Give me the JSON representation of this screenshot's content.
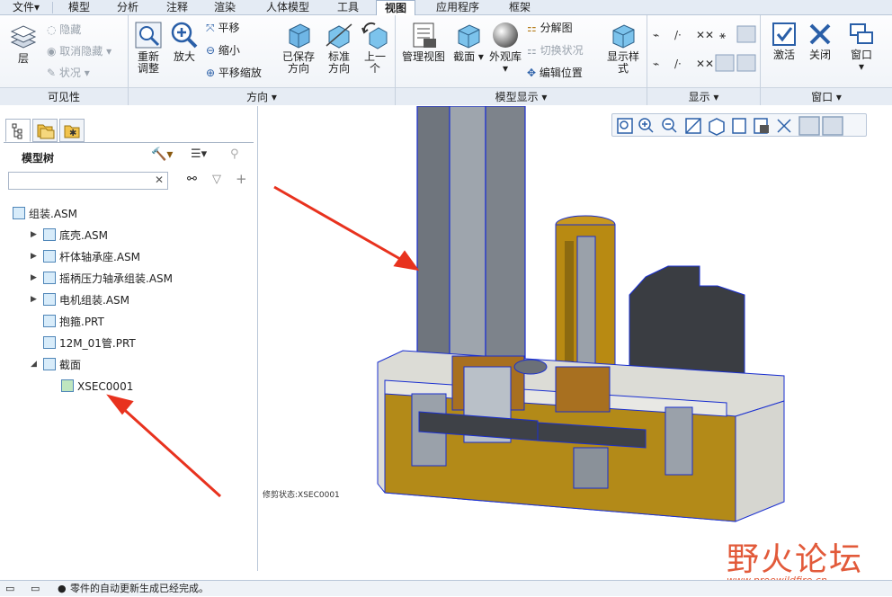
{
  "menubar": {
    "items": [
      "文件▾",
      "模型",
      "分析",
      "注释",
      "渲染",
      "人体模型",
      "工具",
      "视图",
      "应用程序",
      "框架"
    ],
    "active": "视图"
  },
  "ribbon": {
    "visibility": {
      "label": "可见性",
      "layer": "层",
      "hide": "隐藏",
      "unhide": "取消隐藏",
      "status": "状况"
    },
    "orientation": {
      "label": "方向",
      "refit": "重新调整",
      "zoom_in": "放大",
      "pan": "平移",
      "zoom_out": "缩小",
      "pan_zoom": "平移缩放",
      "saved_views": "已保存方向",
      "standard": "标准方向",
      "previous": "上一个"
    },
    "model_display": {
      "label": "模型显示",
      "manage_views": "管理视图",
      "section": "截面",
      "appearance": "外观库",
      "exploded": "分解图",
      "toggle_status": "切换状况",
      "edit_position": "编辑位置",
      "display_style": "显示样式"
    },
    "show": {
      "label": "显示"
    },
    "window": {
      "label": "窗口",
      "activate": "激活",
      "close": "关闭",
      "window": "窗口"
    }
  },
  "panel": {
    "title": "模型树",
    "search_placeholder": "",
    "tree": [
      {
        "name": "组装.ASM",
        "level": 0,
        "expand": ""
      },
      {
        "name": "底壳.ASM",
        "level": 1,
        "expand": "▶"
      },
      {
        "name": "杆体轴承座.ASM",
        "level": 1,
        "expand": "▶"
      },
      {
        "name": "摇柄压力轴承组装.ASM",
        "level": 1,
        "expand": "▶"
      },
      {
        "name": "电机组装.ASM",
        "level": 1,
        "expand": "▶"
      },
      {
        "name": "抱箍.PRT",
        "level": 1,
        "expand": ""
      },
      {
        "name": "12M_01管.PRT",
        "level": 1,
        "expand": ""
      },
      {
        "name": "截面",
        "level": 1,
        "expand": "◢"
      },
      {
        "name": "XSEC0001",
        "level": 2,
        "expand": ""
      }
    ]
  },
  "viewport": {
    "clip_status": "修剪状态:XSEC0001"
  },
  "status": {
    "message": "零件的自动更新生成已经完成。"
  },
  "watermark": {
    "main": "野火论坛",
    "sub": "www.proewildfire.cn"
  },
  "colors": {
    "accent": "#2a5fa8",
    "annotation_arrow": "#e8321e",
    "model_gold": "#b88a12",
    "model_gray": "#8a8f96"
  }
}
